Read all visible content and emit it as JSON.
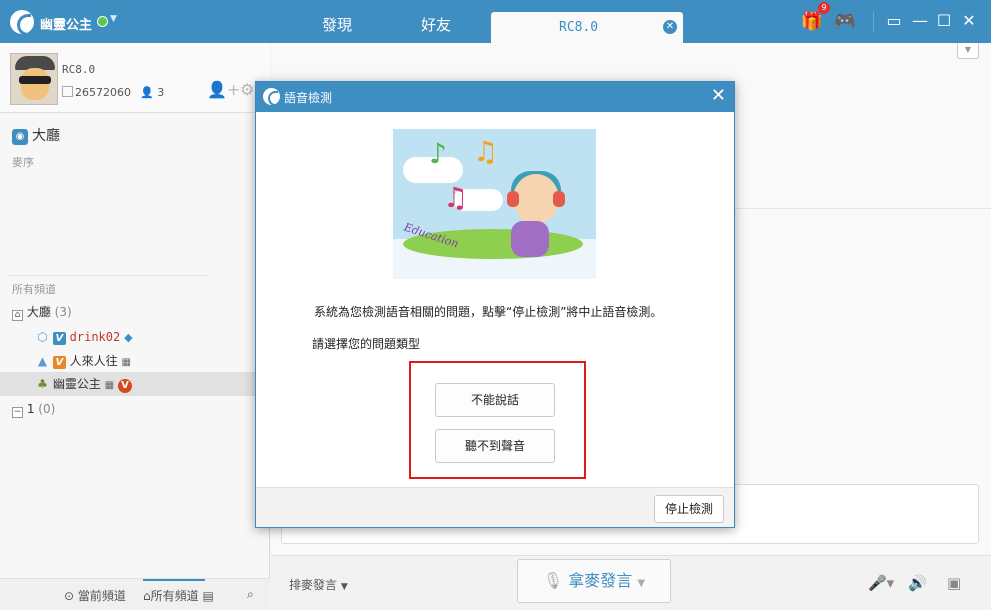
{
  "header": {
    "username": "幽靈公主",
    "tabs": [
      "發現",
      "好友"
    ],
    "active_tab": "RC8.0",
    "gift_badge": "9"
  },
  "profile": {
    "name": "RC8.0",
    "id": "26572060",
    "fans": "3"
  },
  "left": {
    "hall_label": "大廳",
    "mic_order_label": "麥序",
    "all_channels_label": "所有頻道",
    "tree": [
      {
        "label": "大廳",
        "count": "(3)"
      },
      {
        "label": "drink02"
      },
      {
        "label": "人來人往"
      },
      {
        "label": "幽靈公主"
      },
      {
        "label": "1",
        "count": "(0)"
      }
    ],
    "bottom": {
      "current_channel": "當前頻道",
      "all_channels": "所有頻道"
    }
  },
  "right": {
    "mic_mode": "排麥發言",
    "mic_button": "拿麥發言"
  },
  "dialog": {
    "title": "語音檢測",
    "message": "系統為您檢測語音相關的問題，點擊“停止檢測”將中止語音檢測。",
    "prompt": "請選擇您的問題類型",
    "option_1": "不能說話",
    "option_2": "聽不到聲音",
    "stop_button": "停止檢測",
    "illustration_text": "Education"
  }
}
